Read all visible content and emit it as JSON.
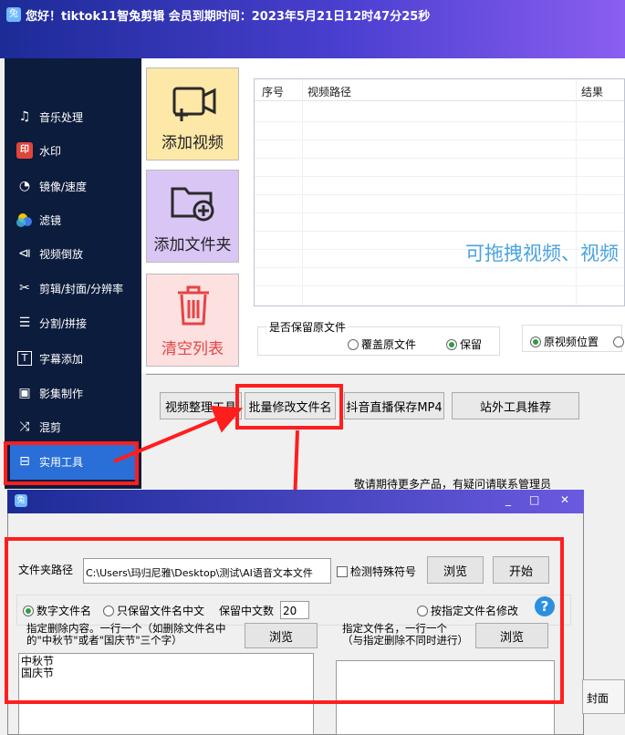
{
  "window": {
    "title": "您好！tiktok11智兔剪辑 会员到期时间：2023年5月21日12时47分25秒"
  },
  "sidebar": {
    "items": [
      {
        "label": "音乐处理",
        "icon": "music-note-icon"
      },
      {
        "label": "水印",
        "icon": "watermark-icon"
      },
      {
        "label": "镜像/速度",
        "icon": "speed-gauge-icon"
      },
      {
        "label": "滤镜",
        "icon": "filter-circles-icon"
      },
      {
        "label": "视频倒放",
        "icon": "reverse-play-icon"
      },
      {
        "label": "剪辑/封面/分辨率",
        "icon": "scissors-icon"
      },
      {
        "label": "分割/拼接",
        "icon": "split-icon"
      },
      {
        "label": "字幕添加",
        "icon": "subtitle-t-icon"
      },
      {
        "label": "影集制作",
        "icon": "album-icon"
      },
      {
        "label": "混剪",
        "icon": "shuffle-icon"
      },
      {
        "label": "实用工具",
        "icon": "toolbox-icon"
      }
    ]
  },
  "actions": {
    "add_video": "添加视频",
    "add_folder": "添加文件夹",
    "clear_list": "清空列表"
  },
  "table": {
    "columns": [
      "序号",
      "视频路径",
      "结果"
    ],
    "drag_hint": "可拖拽视频、视频"
  },
  "options": {
    "keep_original_label": "是否保留原文件",
    "overwrite_label": "覆盖原文件",
    "keep_label": "保留",
    "original_position_label": "原视频位置"
  },
  "tools": {
    "video_organize": "视频整理工具",
    "batch_rename": "批量修改文件名",
    "douyin_live": "抖音直播保存MP4",
    "external_tools": "站外工具推荐",
    "hint": "敬请期待更多产品，有疑问请联系管理员"
  },
  "dialog": {
    "controls": {
      "minimize": "_",
      "maximize": "□",
      "close": "✕"
    },
    "folder_path_label": "文件夹路径",
    "folder_path_value": "C:\\Users\\玛归尼雅\\Desktop\\测试\\AI语音文本文件",
    "detect_special_label": "检测特殊符号",
    "browse_label": "浏览",
    "start_label": "开始",
    "numeric_name_label": "数字文件名",
    "keep_chinese_label": "只保留文件名中文",
    "keep_chinese_count_label": "保留中文数",
    "keep_chinese_count_value": "20",
    "by_name_label": "按指定文件名修改",
    "help_glyph": "?",
    "delete_hint_line1": "指定删除内容。一行一个（如删除文件名中",
    "delete_hint_line2": "的\"中秋节\"或者\"国庆节\"三个字）",
    "browse_label_2": "浏览",
    "name_hint_line1": "指定文件名，一行一个",
    "name_hint_line2": "（与指定删除不同时进行）",
    "browse_label_3": "浏览",
    "delete_content": "中秋节\n国庆节",
    "cover_tab": "封面"
  }
}
